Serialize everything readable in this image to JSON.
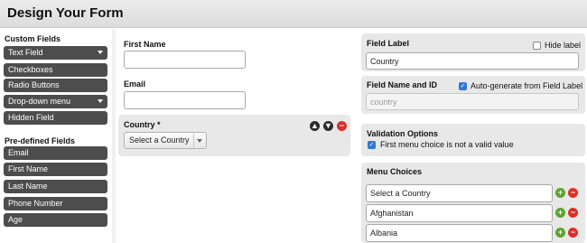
{
  "header": {
    "title": "Design Your Form"
  },
  "sidebar": {
    "custom_heading": "Custom Fields",
    "custom_items": [
      {
        "label": "Text Field"
      },
      {
        "label": "Checkboxes"
      },
      {
        "label": "Radio Buttons"
      },
      {
        "label": "Drop-down menu"
      },
      {
        "label": "Hidden Field"
      }
    ],
    "predefined_heading": "Pre-defined Fields",
    "predefined_items": [
      {
        "label": "Email"
      },
      {
        "label": "First Name"
      },
      {
        "label": "Last Name"
      },
      {
        "label": "Phone Number"
      },
      {
        "label": "Age"
      }
    ]
  },
  "form": {
    "first_name_label": "First Name",
    "first_name_value": "",
    "email_label": "Email",
    "email_value": "",
    "country_label": "Country *",
    "country_selected": "Select a Country"
  },
  "settings": {
    "field_label_heading": "Field Label",
    "hide_label_text": "Hide label",
    "hide_label_checked": false,
    "field_label_value": "Country",
    "field_name_heading": "Field Name and ID",
    "autogen_text": "Auto-generate from Field Label",
    "autogen_checked": true,
    "field_name_value": "country",
    "validation_heading": "Validation Options",
    "validation_option_text": "First menu choice is not a valid value",
    "validation_checked": true,
    "menu_choices_heading": "Menu Choices",
    "menu_choices": [
      {
        "value": "Select a Country"
      },
      {
        "value": "Afghanistan"
      },
      {
        "value": "Albania"
      }
    ]
  },
  "colors": {
    "sidebar_button": "#4d4d4d",
    "panel_bg": "#e8e8e8",
    "add_green": "#5aa52a",
    "remove_red": "#d8312b",
    "checkbox_blue": "#2f78d6"
  }
}
